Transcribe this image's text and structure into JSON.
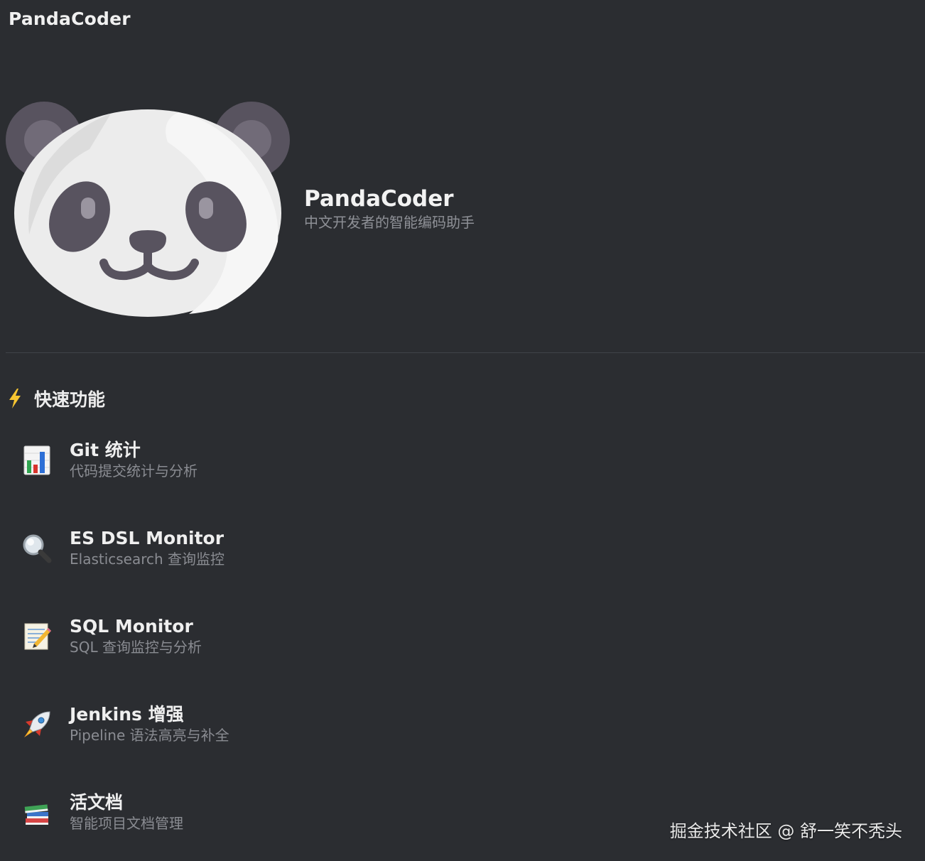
{
  "topbar": {
    "title": "PandaCoder"
  },
  "hero": {
    "logo_icon": "panda-face-icon",
    "brand_name": "PandaCoder",
    "tagline": "中文开发者的智能编码助手"
  },
  "quick": {
    "icon": "lightning-icon",
    "title": "快速功能",
    "items": [
      {
        "icon": "bar-chart-icon",
        "title": "Git 统计",
        "desc": "代码提交统计与分析"
      },
      {
        "icon": "magnifier-icon",
        "title": "ES DSL Monitor",
        "desc": "Elasticsearch 查询监控"
      },
      {
        "icon": "memo-pencil-icon",
        "title": "SQL Monitor",
        "desc": "SQL 查询监控与分析"
      },
      {
        "icon": "rocket-icon",
        "title": "Jenkins 增强",
        "desc": "Pipeline 语法高亮与补全"
      },
      {
        "icon": "books-icon",
        "title": "活文档",
        "desc": "智能项目文档管理"
      }
    ]
  },
  "watermark": "掘金技术社区 @ 舒一笑不秃头",
  "colors": {
    "background": "#2b2d31",
    "panda_white": "#ececec",
    "panda_dark": "#58535f",
    "muted_text": "#8a8c92",
    "accent_lightning": "#f7c531"
  }
}
